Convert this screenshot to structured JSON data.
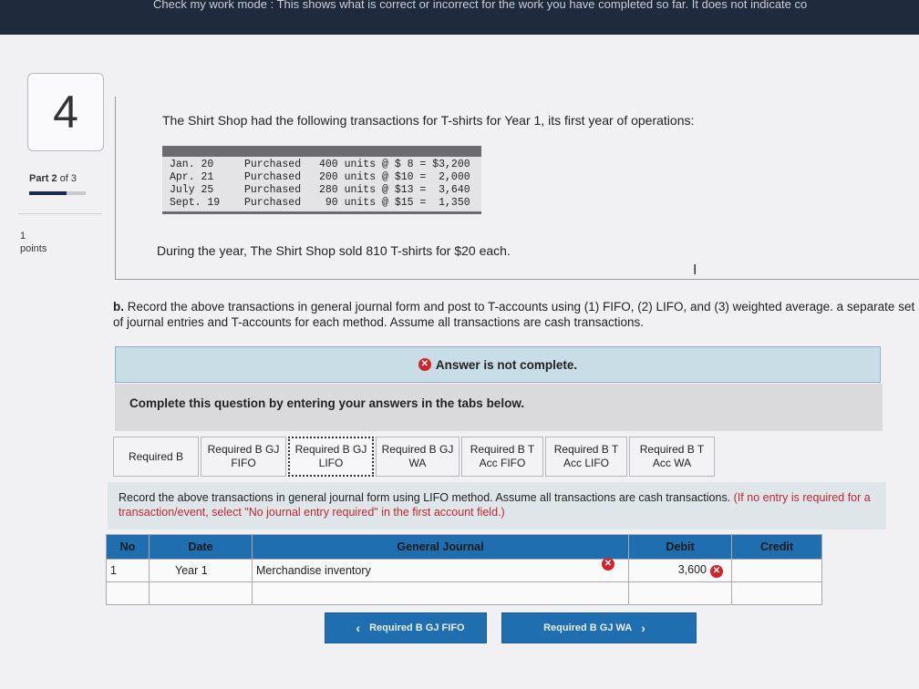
{
  "top_banner": "Check my work mode : This shows what is correct or incorrect for the work you have completed so far. It does not indicate co",
  "question": {
    "number": "4",
    "part_label_bold": "Part 2",
    "part_label_rest": " of 3",
    "part_progress": 0.66,
    "points_value": "1",
    "points_label": "points"
  },
  "intro_text": "The Shirt Shop had the following transactions for T-shirts for Year 1, its first year of operations:",
  "transactions": [
    {
      "date": "Jan. 20",
      "type": "Purchased",
      "detail": "400 units @ $ 8 = $3,200"
    },
    {
      "date": "Apr. 21",
      "type": "Purchased",
      "detail": "200 units @ $10 =  2,000"
    },
    {
      "date": "July 25",
      "type": "Purchased",
      "detail": "280 units @ $13 =  3,640"
    },
    {
      "date": "Sept. 19",
      "type": "Purchased",
      "detail": " 90 units @ $15 =  1,350"
    }
  ],
  "sold_text": "During the year, The Shirt Shop sold 810 T-shirts for $20 each.",
  "part_b": {
    "prefix": "b.",
    "text": " Record the above transactions in general journal form and post to T-accounts using (1) FIFO, (2) LIFO, and (3) weighted average. a separate set of journal entries and T-accounts for each method. Assume all transactions are cash transactions."
  },
  "alert_text": "Answer is not complete.",
  "complete_text": "Complete this question by entering your answers in the tabs below.",
  "tabs": [
    {
      "label": "Required B"
    },
    {
      "label": "Required B GJ FIFO"
    },
    {
      "label": "Required B GJ LIFO"
    },
    {
      "label": "Required B GJ WA"
    },
    {
      "label": "Required B T Acc FIFO"
    },
    {
      "label": "Required B T Acc LIFO"
    },
    {
      "label": "Required B T Acc WA"
    }
  ],
  "instructions": {
    "main": "Record the above transactions in general journal form using LIFO method. Assume all transactions are cash transactions. ",
    "note": "(If no entry is required for a transaction/event, select \"No journal entry required\" in the first account field.)"
  },
  "journal": {
    "headers": {
      "no": "No",
      "date": "Date",
      "account": "General Journal",
      "debit": "Debit",
      "credit": "Credit"
    },
    "rows": [
      {
        "no": "1",
        "date": "Year 1",
        "account": "Merchandise inventory",
        "debit": "3,600",
        "credit": ""
      },
      {
        "no": "",
        "date": "",
        "account": "",
        "debit": "",
        "credit": ""
      }
    ]
  },
  "nav": {
    "prev_label": "Required B GJ FIFO",
    "next_label": "Required B GJ WA"
  },
  "colors": {
    "header_blue": "#1f6fb0",
    "error_red": "#d2232a",
    "alert_bg": "#c8dde6"
  }
}
